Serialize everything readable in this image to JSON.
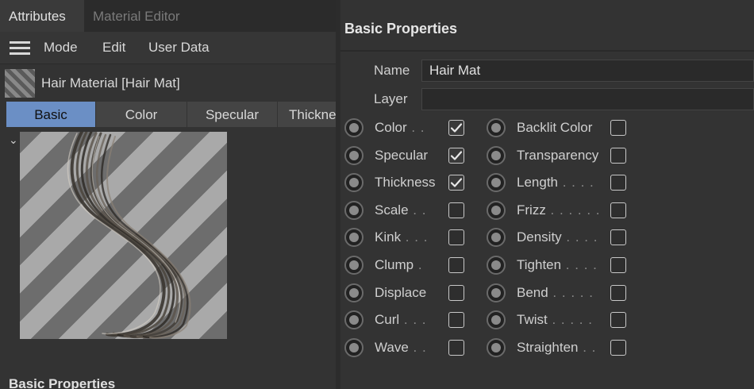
{
  "tabs": {
    "attributes": "Attributes",
    "material_editor": "Material Editor"
  },
  "menu": {
    "mode": "Mode",
    "edit": "Edit",
    "user_data": "User Data"
  },
  "object": {
    "title": "Hair Material [Hair Mat]"
  },
  "subtabs": [
    "Basic",
    "Color",
    "Specular",
    "Thickne"
  ],
  "section": {
    "title": "Basic Properties",
    "bottom_title": "Basic Properties"
  },
  "fields": {
    "name_label": "Name",
    "name_value": "Hair Mat",
    "layer_label": "Layer",
    "layer_value": ""
  },
  "left_props": [
    {
      "label": "Color",
      "dots": " . .",
      "checked": true
    },
    {
      "label": "Specular",
      "dots": "",
      "checked": true
    },
    {
      "label": "Thickness",
      "dots": "",
      "checked": true
    },
    {
      "label": "Scale",
      "dots": " . .",
      "checked": false
    },
    {
      "label": "Kink",
      "dots": " . . .",
      "checked": false
    },
    {
      "label": "Clump",
      "dots": " .",
      "checked": false
    },
    {
      "label": "Displace",
      "dots": "",
      "checked": false
    },
    {
      "label": "Curl",
      "dots": " . . .",
      "checked": false
    },
    {
      "label": "Wave",
      "dots": " . .",
      "checked": false
    }
  ],
  "right_props": [
    {
      "label": "Backlit Color",
      "dots": "",
      "checked": false
    },
    {
      "label": "Transparency",
      "dots": "",
      "checked": false
    },
    {
      "label": "Length",
      "dots": " . . . .",
      "checked": false
    },
    {
      "label": "Frizz",
      "dots": " . . . . . .",
      "checked": false
    },
    {
      "label": "Density",
      "dots": " . . . .",
      "checked": false
    },
    {
      "label": "Tighten",
      "dots": " . . . .",
      "checked": false
    },
    {
      "label": "Bend",
      "dots": " . . . . .",
      "checked": false
    },
    {
      "label": "Twist",
      "dots": " . . . . .",
      "checked": false
    },
    {
      "label": "Straighten",
      "dots": " . .",
      "checked": false
    }
  ],
  "colors": {
    "accent": "#6b8fc5",
    "background": "#333333"
  }
}
